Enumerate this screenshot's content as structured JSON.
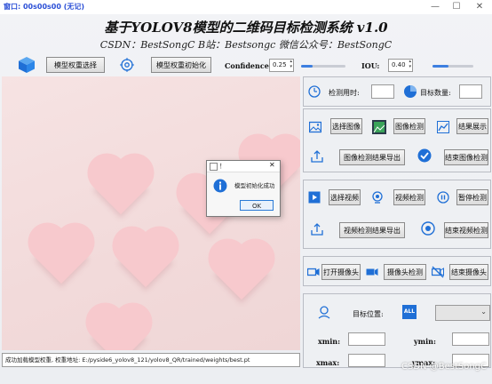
{
  "window": {
    "title_bar_text": "窗口: 00s00s00 (无记)",
    "minimize": "—",
    "maximize": "☐",
    "close": "✕"
  },
  "header": {
    "title": "基于YOLOV8模型的二维码目标检测系统 v1.0",
    "subtitle": "CSDN：BestSongC   B站：Bestsongc   微信公众号：BestSongC"
  },
  "toolbar": {
    "model_select_label": "模型权重选择",
    "model_init_label": "模型权重初始化",
    "confidence_label": "Confidence:",
    "confidence_value": "0.25",
    "confidence_level": 0.25,
    "iou_label": "IOU:",
    "iou_value": "0.40",
    "iou_level": 0.4
  },
  "status_bar": {
    "message": "成功加载模型权重, 权重地址: E:/pyside6_yolov8_121/yolov8_QR/trained/weights/best.pt"
  },
  "dialog": {
    "title": "！",
    "close": "✕",
    "message": "模型初始化成功",
    "ok_label": "OK"
  },
  "stats": {
    "time_label": "检测用时:",
    "time_value": "",
    "count_label": "目标数量:",
    "count_value": ""
  },
  "image_panel": {
    "select_image": "选择图像",
    "image_detect": "图像检测",
    "result_show": "结果展示",
    "export_result": "图像检测结果导出",
    "end_detect": "结束图像检测"
  },
  "video_panel": {
    "select_video": "选择视频",
    "video_detect": "视频检测",
    "pause_detect": "暂停检测",
    "export_result": "视频检测结果导出",
    "end_detect": "结束视频检测"
  },
  "camera_panel": {
    "open_camera": "打开摄像头",
    "camera_detect": "摄像头检测",
    "close_camera": "结束摄像头"
  },
  "location_panel": {
    "target_position_label": "目标位置:",
    "all_badge": "ALL",
    "target_select_value": "",
    "xmin_label": "xmin:",
    "ymin_label": "ymin:",
    "xmax_label": "xmax:",
    "ymax_label": "ymax:",
    "xmin_value": "",
    "ymin_value": "",
    "xmax_value": "",
    "ymax_value": ""
  },
  "watermark": "CSDN @BestSongC",
  "colors": {
    "accent_blue": "#1f6fd6",
    "slider_blue": "#3d7fe0",
    "heart_pink": "#f7c9cd",
    "canvas_bg": "#f3dcdc"
  }
}
